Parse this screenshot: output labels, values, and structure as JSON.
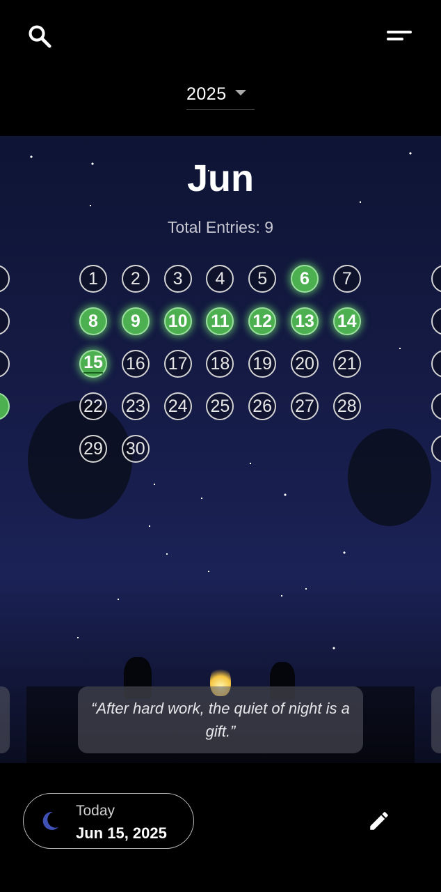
{
  "header": {
    "year": "2025",
    "icons": {
      "search": "search-icon",
      "menu": "sort-menu-icon",
      "dropdown": "dropdown-caret-icon"
    }
  },
  "calendar": {
    "month": "Jun",
    "entries_label": "Total Entries: 9",
    "days": [
      "1",
      "2",
      "3",
      "4",
      "5",
      "6",
      "7",
      "8",
      "9",
      "10",
      "11",
      "12",
      "13",
      "14",
      "15",
      "16",
      "17",
      "18",
      "19",
      "20",
      "21",
      "22",
      "23",
      "24",
      "25",
      "26",
      "27",
      "28",
      "29",
      "30"
    ],
    "entry_days": [
      6,
      8,
      9,
      10,
      11,
      12,
      13,
      14,
      15
    ],
    "today_day": 15,
    "first_weekday_offset": 0,
    "colors": {
      "entry": "#4caf50",
      "entry_glow": "#9be09e"
    }
  },
  "quote": {
    "text": "“After hard work, the quiet of night is a gift.”"
  },
  "footer": {
    "today_label": "Today",
    "today_date": "Jun 15, 2025",
    "icons": {
      "moon": "moon-icon",
      "edit": "edit-pencil-icon"
    }
  }
}
